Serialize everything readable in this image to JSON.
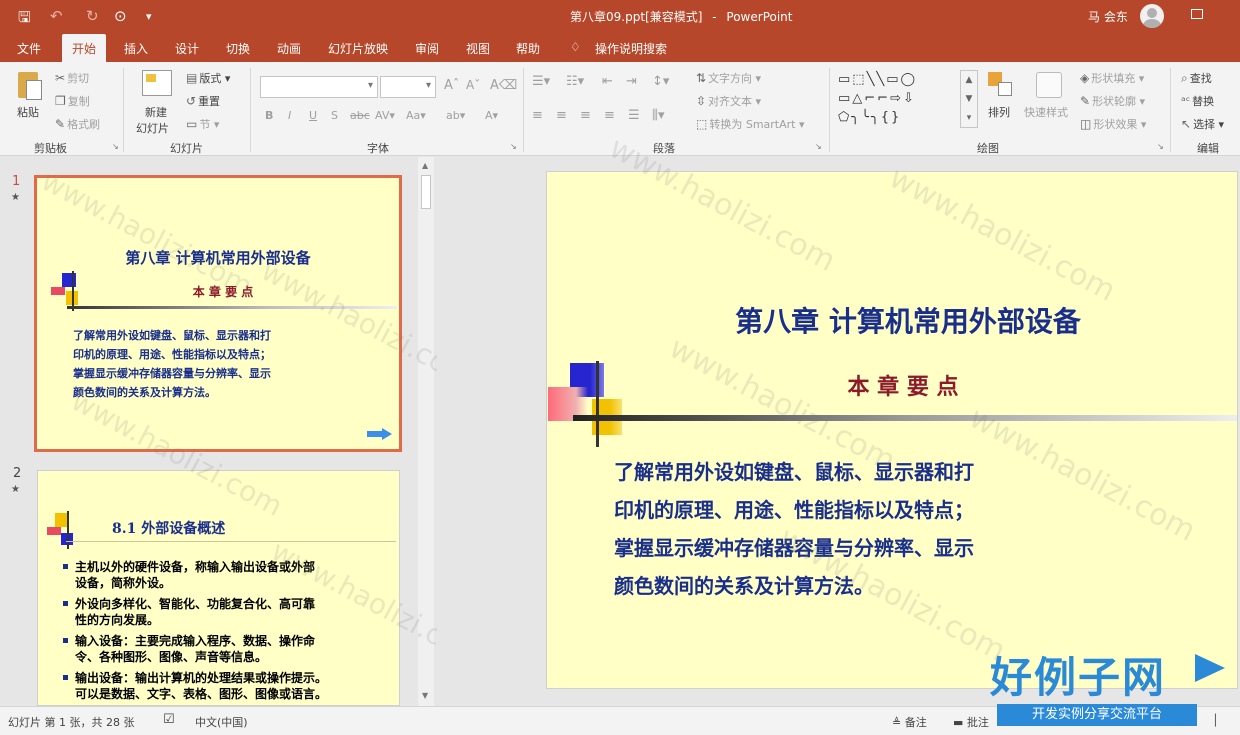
{
  "title": {
    "document": "第八章09.ppt",
    "mode": "[兼容模式]",
    "separator": "-",
    "app": "PowerPoint",
    "user": "马 会东"
  },
  "menu": {
    "tabs": [
      "文件",
      "开始",
      "插入",
      "设计",
      "切换",
      "动画",
      "幻灯片放映",
      "审阅",
      "视图",
      "帮助"
    ],
    "active": "开始",
    "tellme": "操作说明搜索"
  },
  "ribbon": {
    "clipboard": {
      "paste": "粘贴",
      "cut": "剪切",
      "copy": "复制",
      "format_painter": "格式刷",
      "group": "剪贴板"
    },
    "slides": {
      "new_slide": "新建",
      "new_slide2": "幻灯片",
      "layout": "版式",
      "reset": "重置",
      "section": "节",
      "group": "幻灯片"
    },
    "font": {
      "bold": "B",
      "italic": "I",
      "underline": "U",
      "strike": "S",
      "group": "字体"
    },
    "paragraph": {
      "text_direction": "文字方向",
      "align_text": "对齐文本",
      "smartart": "转换为 SmartArt",
      "group": "段落"
    },
    "drawing": {
      "arrange": "排列",
      "quick_styles": "快速样式",
      "shape_fill": "形状填充",
      "shape_outline": "形状轮廓",
      "shape_effects": "形状效果",
      "group": "绘图"
    },
    "editing": {
      "find": "查找",
      "replace": "替换",
      "select": "选择",
      "group": "编辑"
    }
  },
  "slides": [
    {
      "number": "1",
      "star": "★",
      "title": "第八章  计算机常用外部设备",
      "subtitle": "本 章 要 点",
      "body": [
        "了解常用外设如键盘、鼠标、显示器和打",
        "印机的原理、用途、性能指标以及特点；",
        "掌握显示缓冲存储器容量与分辨率、显示",
        "颜色数间的关系及计算方法。"
      ]
    },
    {
      "number": "2",
      "star": "★",
      "heading": "8.1  外部设备概述",
      "bullets": [
        [
          "主机以外的硬件设备，称输入输出设备或外部",
          "设备，简称外设。"
        ],
        [
          "外设向多样化、智能化、功能复合化、高可靠",
          "性的方向发展。"
        ],
        [
          "输入设备：主要完成输入程序、数据、操作命",
          "令、各种图形、图像、声音等信息。"
        ],
        [
          "输出设备：输出计算机的处理结果或操作提示。",
          "可以是数据、文字、表格、图形、图像或语言。"
        ]
      ]
    }
  ],
  "watermark": "www.haolizi.com",
  "logo": {
    "name": "好例子网",
    "tagline": "开发实例分享交流平台"
  },
  "status": {
    "slide_info": "幻灯片 第 1 张，共 28 张",
    "language": "中文(中国)",
    "notes": "备注",
    "comments": "批注"
  }
}
